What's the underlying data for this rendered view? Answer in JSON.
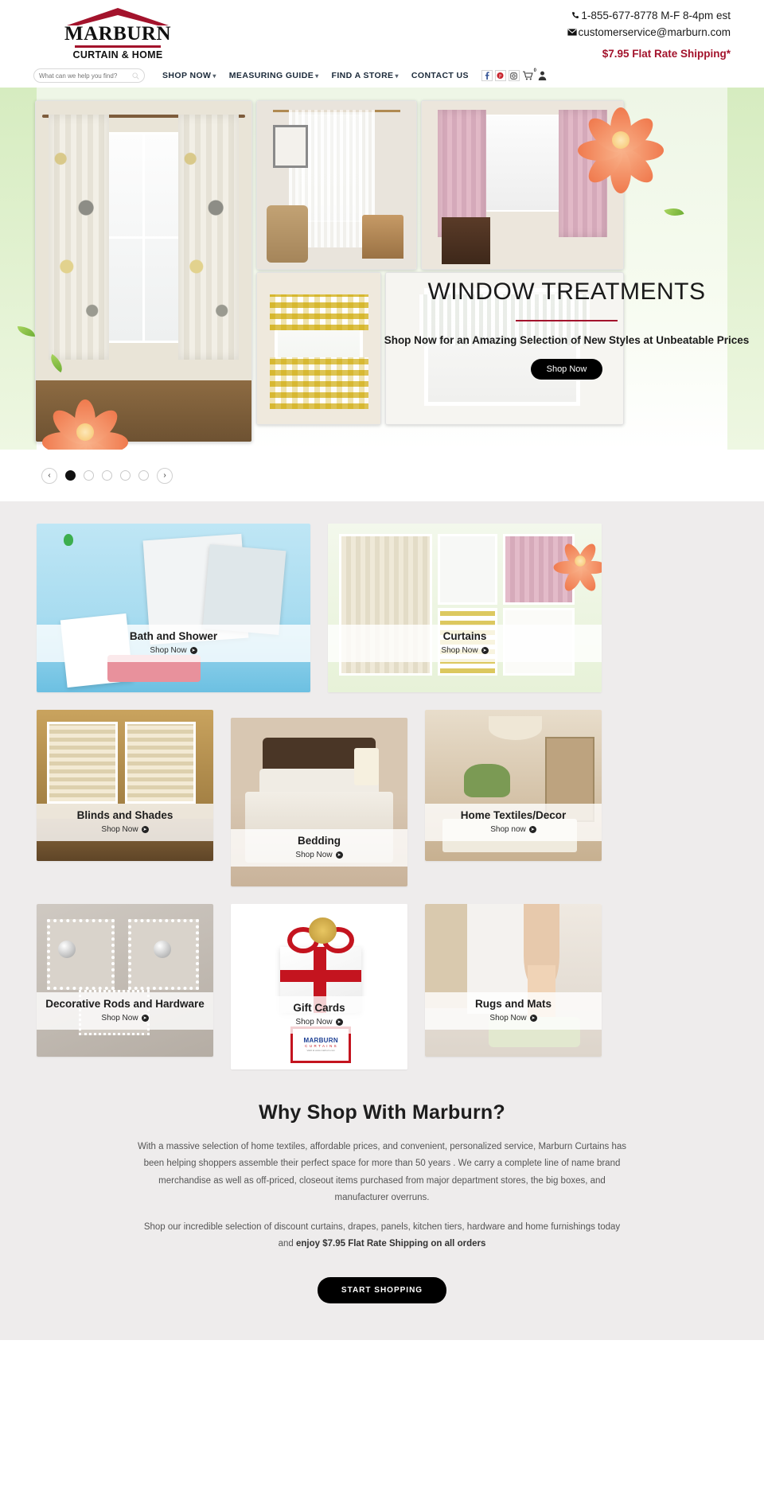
{
  "brand": {
    "name": "MARBURN",
    "tagline": "CURTAIN & HOME",
    "accent_color": "#a3132c"
  },
  "header": {
    "phone": "1-855-677-8778 M-F 8-4pm est",
    "email": "customerservice@marburn.com",
    "shipping_note": "$7.95 Flat Rate Shipping*",
    "phone_icon": "phone-icon",
    "email_icon": "envelope-icon"
  },
  "search": {
    "placeholder": "What can we help you find?",
    "value": "",
    "icon": "search-icon"
  },
  "nav": {
    "items": [
      {
        "label": "SHOP NOW",
        "has_caret": true
      },
      {
        "label": "MEASURING GUIDE",
        "has_caret": true
      },
      {
        "label": "FIND A STORE",
        "has_caret": true
      },
      {
        "label": "CONTACT US",
        "has_caret": false
      }
    ],
    "icons": [
      {
        "name": "facebook-icon",
        "glyph": "f"
      },
      {
        "name": "pinterest-icon",
        "glyph": "P"
      },
      {
        "name": "instagram-icon",
        "glyph": "▣"
      }
    ],
    "cart": {
      "name": "cart-icon",
      "count": "0"
    },
    "account": {
      "name": "user-account-icon"
    }
  },
  "hero": {
    "title": "WINDOW TREATMENTS",
    "subtitle": "Shop Now for an Amazing Selection of New Styles at Unbeatable Prices",
    "button_label": "Shop Now",
    "accent_color": "#a3132c",
    "carousel": {
      "prev_label": "‹",
      "next_label": "›",
      "slide_count": 5,
      "active_index": 0
    }
  },
  "categories": {
    "shop_now_label": "Shop Now",
    "row1": [
      {
        "title": "Bath and Shower",
        "cta": "Shop Now",
        "art": "art-bath"
      },
      {
        "title": "Curtains",
        "cta": "Shop Now",
        "art": "art-curtains"
      }
    ],
    "row2": [
      {
        "title": "Blinds and Shades",
        "cta": "Shop Now",
        "art": "art-blinds"
      },
      {
        "title": "Bedding",
        "cta": "Shop Now",
        "art": "art-bedding"
      },
      {
        "title": "Home Textiles/Decor",
        "cta": "Shop now",
        "art": "art-home"
      }
    ],
    "row3": [
      {
        "title": "Decorative Rods and Hardware",
        "cta": "Shop Now",
        "art": "art-rods"
      },
      {
        "title": "Gift Cards",
        "cta": "Shop Now",
        "art": "art-gift"
      },
      {
        "title": "Rugs and Mats",
        "cta": "Shop Now",
        "art": "art-rugs"
      }
    ],
    "giftcard": {
      "brand": "MARBURN",
      "sub": "C U R T A I N S",
      "fineprint": "Valid at www.marburn.com"
    }
  },
  "why": {
    "heading": "Why Shop With Marburn?",
    "p1": "With a massive selection of home textiles, affordable prices, and convenient, personalized service, Marburn Curtains has been helping shoppers assemble their perfect space for more than 50 years . We carry a complete line of name brand merchandise as well as off-priced, closeout items purchased from major department stores, the big boxes, and manufacturer overruns.",
    "p2_lead": "Shop our incredible selection of discount curtains, drapes, panels, kitchen tiers, hardware and home furnishings today and ",
    "p2_bold": "enjoy $7.95 Flat Rate Shipping on all orders",
    "button_label": "START SHOPPING"
  }
}
